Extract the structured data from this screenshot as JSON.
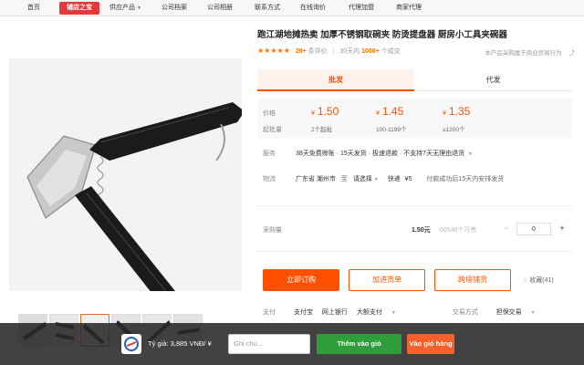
{
  "nav": {
    "items": [
      "首页",
      "供应产品",
      "公司档案",
      "公司相册",
      "联系方式",
      "在线询价",
      "代理加盟",
      "商家代理"
    ],
    "logo_text": "铺店之宝"
  },
  "product": {
    "title": "跑江湖地摊热卖 加厚不锈钢取碗夹 防烫提盘器 厨房小工具夹碗器",
    "rating_count": "20+",
    "rating_label": "条评价",
    "sales_label": "30天内",
    "sales_count": "1000+",
    "sales_suffix": "个成交",
    "service_note": "本产品采购属于商业贸易行为"
  },
  "tabs": [
    {
      "label": "批发",
      "active": true
    },
    {
      "label": "代发",
      "active": false
    }
  ],
  "pricing": {
    "price_label": "价格",
    "moq_label": "起批量",
    "currency": "¥",
    "tiers": [
      {
        "price": "1.50",
        "qty": "2个起批"
      },
      {
        "price": "1.45",
        "qty": "100-1199个"
      },
      {
        "price": "1.35",
        "qty": "≥1200个"
      }
    ]
  },
  "service": {
    "label": "服务",
    "text": "38天免费赊账 · 15天发货 · 极速退款 · 不支持7天无理由退货"
  },
  "logistics": {
    "label": "物流",
    "from": "广东省 潮州市",
    "to_label": "至",
    "to_select": "请选择",
    "method": "快递",
    "fee": "¥5",
    "note": "付款成功后15天内安排发货"
  },
  "purchase": {
    "label": "采购量",
    "unit_price": "1.50元",
    "stock": "66548个可售",
    "quantity": "0",
    "minus": "−",
    "plus": "+"
  },
  "actions": {
    "order": "立即订购",
    "cart": "加进货单",
    "cross": "跨境铺货",
    "favorite": "收藏(41)"
  },
  "payment": {
    "label": "支付",
    "options": [
      "支付宝",
      "网上银行",
      "大额支付"
    ],
    "trade_label": "交易方式",
    "trade_value": "担保交易"
  },
  "overlay": {
    "rate": "Tỷ giá: 3,885 VNĐ/ ¥",
    "note_placeholder": "Ghi chú...",
    "add_cart": "Thêm vào giỏ",
    "cart": "Vào giỏ hàng"
  },
  "colors": {
    "accent": "#ff5000",
    "logo": "#e4393c",
    "green": "#2e9d3a"
  }
}
